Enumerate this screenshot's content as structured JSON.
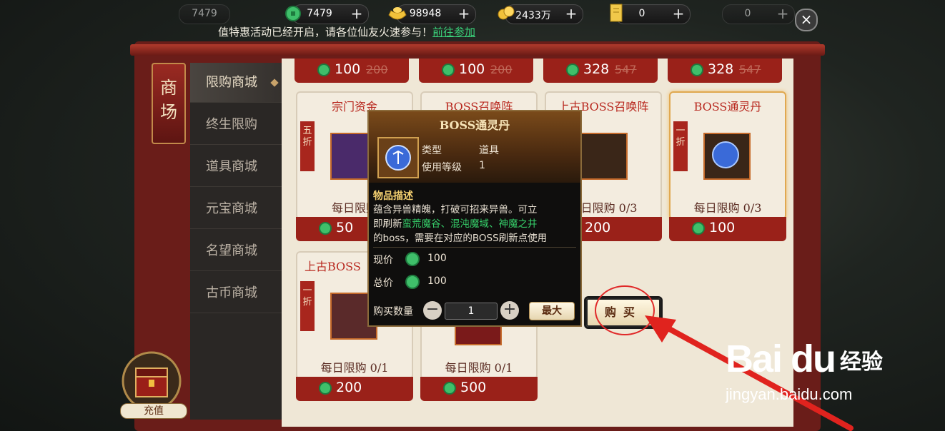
{
  "resources": {
    "ghost": {
      "value": "7479"
    },
    "jade": {
      "value": "7479"
    },
    "gold_ingot": {
      "value": "98948"
    },
    "coins": {
      "value": "2433万"
    },
    "scroll": {
      "value": "0"
    },
    "ticket": {
      "value": "0"
    }
  },
  "banner": {
    "text": "值特惠活动已经开启，请各位仙友火速参与！",
    "link": "前往参加"
  },
  "shop": {
    "title": "商场",
    "tabs": [
      "限购商城",
      "终生限购",
      "道具商城",
      "元宝商城",
      "名望商城",
      "古币商城"
    ],
    "active_tab": 0
  },
  "top_row_prices": [
    {
      "now": "100",
      "orig": "200"
    },
    {
      "now": "100",
      "orig": "200"
    },
    {
      "now": "328",
      "orig": "547"
    },
    {
      "now": "328",
      "orig": "547"
    }
  ],
  "cards_row1": [
    {
      "name": "宗门资金",
      "discount": "五折",
      "limit": "每日限购",
      "price": "50"
    },
    {
      "name": "BOSS召唤阵",
      "discount": "",
      "limit": "",
      "price": ""
    },
    {
      "name": "上古BOSS召唤阵",
      "discount": "",
      "limit": "每日限购 0/3",
      "price": "200"
    },
    {
      "name": "BOSS通灵丹",
      "discount": "一折",
      "limit": "每日限购 0/3",
      "price": "100"
    }
  ],
  "cards_row2": [
    {
      "name": "上古BOSS",
      "discount": "一折",
      "limit": "每日限购 0/1",
      "price": "200"
    },
    {
      "name": "",
      "discount": "",
      "limit": "每日限购 0/1",
      "price": "500"
    }
  ],
  "tooltip": {
    "title": "BOSS通灵丹",
    "type_label": "类型",
    "type_value": "道具",
    "level_label": "使用等级",
    "level_value": "1",
    "desc_header": "物品描述",
    "desc_1": "蕴含异兽精魄，打破可招来异兽。可立",
    "desc_2a": "即刷新",
    "desc_2g": "蛮荒魔谷、混沌魔域、神魔之井",
    "desc_3": "的boss，需要在对应的BOSS刷新点使用",
    "now_price_label": "现价",
    "now_price": "100",
    "total_price_label": "总价",
    "total_price": "100",
    "qty_label": "购买数量",
    "qty": "1",
    "max_label": "最大"
  },
  "buy_button": "购买",
  "topup_label": "充值",
  "watermark": {
    "brand": "Bai du",
    "suffix": "经验",
    "url": "jingyan.baidu.com"
  }
}
